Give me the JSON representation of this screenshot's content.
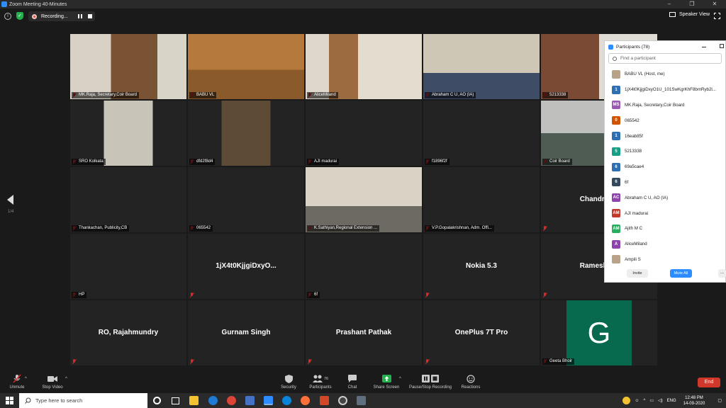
{
  "window": {
    "title": "Zoom Meeting 40-Minutes",
    "controls": [
      "–",
      "❐",
      "✕"
    ]
  },
  "topbar": {
    "recording_label": "Recording...",
    "speaker_view_label": "Speaker View"
  },
  "page_indicator": "1/4",
  "tiles": [
    {
      "name": "MK.Raja, Secretary,Coir Board",
      "big": "",
      "bg": "cam",
      "active": true
    },
    {
      "name": "BABU VL",
      "big": "",
      "bg": "cam"
    },
    {
      "name": "AliceMiland",
      "big": "",
      "bg": "cam"
    },
    {
      "name": "Abraham C U, AO (IA)",
      "big": "",
      "bg": "cam"
    },
    {
      "name": "5213338",
      "big": "",
      "bg": "cam"
    },
    {
      "name": "SRO Kolkata",
      "big": "",
      "bg": "cam"
    },
    {
      "name": "dfd2f8d4",
      "big": "",
      "bg": "cam"
    },
    {
      "name": "AJI madurai",
      "big": "",
      "bg": "plain"
    },
    {
      "name": "f1896f2f",
      "big": "",
      "bg": "plain"
    },
    {
      "name": "Coir Board",
      "big": "",
      "bg": "cam"
    },
    {
      "name": "Thankachan, Publicity,CB",
      "big": "",
      "bg": "plain"
    },
    {
      "name": "065542",
      "big": "",
      "bg": "plain"
    },
    {
      "name": "K.Sathiyan,Regional Extension ...",
      "big": "",
      "bg": "cam"
    },
    {
      "name": "V.P.Gopalakrishnan, Adm. Offi...",
      "big": "",
      "bg": "plain"
    },
    {
      "name": "",
      "big": "Chandrasel",
      "bg": "plain"
    },
    {
      "name": "HP",
      "big": "",
      "bg": "plain"
    },
    {
      "name": "",
      "big": "1jX4t0KjjgiDxyO...",
      "bg": "plain"
    },
    {
      "name": "6f",
      "big": "",
      "bg": "plain"
    },
    {
      "name": "",
      "big": "Nokia 5.3",
      "bg": "plain"
    },
    {
      "name": "",
      "big": "Ramesh Ra",
      "bg": "plain"
    },
    {
      "name": "",
      "big": "RO, Rajahmundry",
      "bg": "plain"
    },
    {
      "name": "",
      "big": "Gurnam Singh",
      "bg": "plain"
    },
    {
      "name": "",
      "big": "Prashant Pathak",
      "bg": "plain"
    },
    {
      "name": "",
      "big": "OnePlus 7T Pro",
      "bg": "plain"
    },
    {
      "name": "Geeta Bhoir",
      "big": "",
      "bg": "avatar",
      "avatar_letter": "G"
    }
  ],
  "participants_panel": {
    "title": "Participants (78)",
    "search_placeholder": "Find a participant",
    "participants": [
      {
        "initials": "",
        "name": "BABU VL (Host, me)",
        "color": "#b9a28a"
      },
      {
        "initials": "1",
        "name": "1jX4t0KjjgiDxyO1U_101SwKgrKhF8bmRyb2l...",
        "color": "#2d6fb0"
      },
      {
        "initials": "MS",
        "name": "MK.Raja, Secretary,Coir Board",
        "color": "#9b59b6"
      },
      {
        "initials": "0",
        "name": "065542",
        "color": "#d35400"
      },
      {
        "initials": "1",
        "name": "16eab85f",
        "color": "#2d6fb0"
      },
      {
        "initials": "5",
        "name": "5213338",
        "color": "#16a085"
      },
      {
        "initials": "6",
        "name": "69a5cae4",
        "color": "#2d6fb0"
      },
      {
        "initials": "6",
        "name": "6f",
        "color": "#34495e"
      },
      {
        "initials": "AC",
        "name": "Abraham C U, AO (IA)",
        "color": "#8e44ad"
      },
      {
        "initials": "AM",
        "name": "AJI madurai",
        "color": "#c0392b"
      },
      {
        "initials": "AM",
        "name": "Ajith M C",
        "color": "#27ae60"
      },
      {
        "initials": "A",
        "name": "AliceMiland",
        "color": "#8e44ad"
      },
      {
        "initials": "",
        "name": "Ampili S",
        "color": "#b9a28a"
      }
    ],
    "invite_label": "Invite",
    "mute_all_label": "Mute All",
    "more_label": "..."
  },
  "toolbar": {
    "unmute": "Unmute",
    "stop_video": "Stop Video",
    "security": "Security",
    "participants": "Participants",
    "participants_count": "76",
    "chat": "Chat",
    "share_screen": "Share Screen",
    "pause_stop_recording": "Pause/Stop Recording",
    "reactions": "Reactions",
    "end": "End"
  },
  "taskbar": {
    "search_placeholder": "Type here to search",
    "language": "ENG",
    "time": "12:48 PM",
    "date": "14-09-2020"
  }
}
